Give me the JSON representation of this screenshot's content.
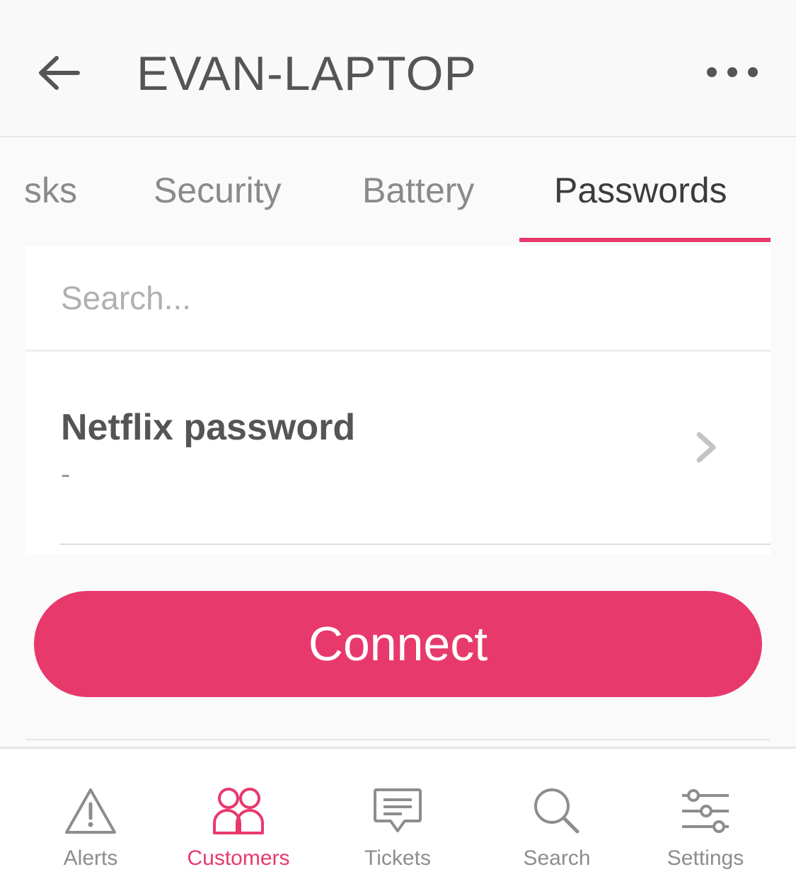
{
  "header": {
    "title": "EVAN-LAPTOP",
    "back_icon": "arrow-left-icon",
    "more_icon": "more-horizontal-icon"
  },
  "tabs": [
    {
      "label": "Tasks",
      "visible_text": "sks",
      "active": false
    },
    {
      "label": "Security",
      "active": false
    },
    {
      "label": "Battery",
      "active": false
    },
    {
      "label": "Passwords",
      "active": true
    }
  ],
  "search": {
    "placeholder": "Search...",
    "value": ""
  },
  "passwords": [
    {
      "title": "Netflix password",
      "subtitle": "-"
    }
  ],
  "connect_label": "Connect",
  "bottom_nav": [
    {
      "label": "Alerts",
      "icon": "warning-icon",
      "active": false
    },
    {
      "label": "Customers",
      "icon": "users-icon",
      "active": true
    },
    {
      "label": "Tickets",
      "icon": "message-icon",
      "active": false
    },
    {
      "label": "Search",
      "icon": "search-icon",
      "active": false
    },
    {
      "label": "Settings",
      "icon": "sliders-icon",
      "active": false
    }
  ],
  "colors": {
    "accent": "#e8396d",
    "text": "#555555",
    "muted": "#8d8d8d",
    "background": "#fafafa"
  }
}
